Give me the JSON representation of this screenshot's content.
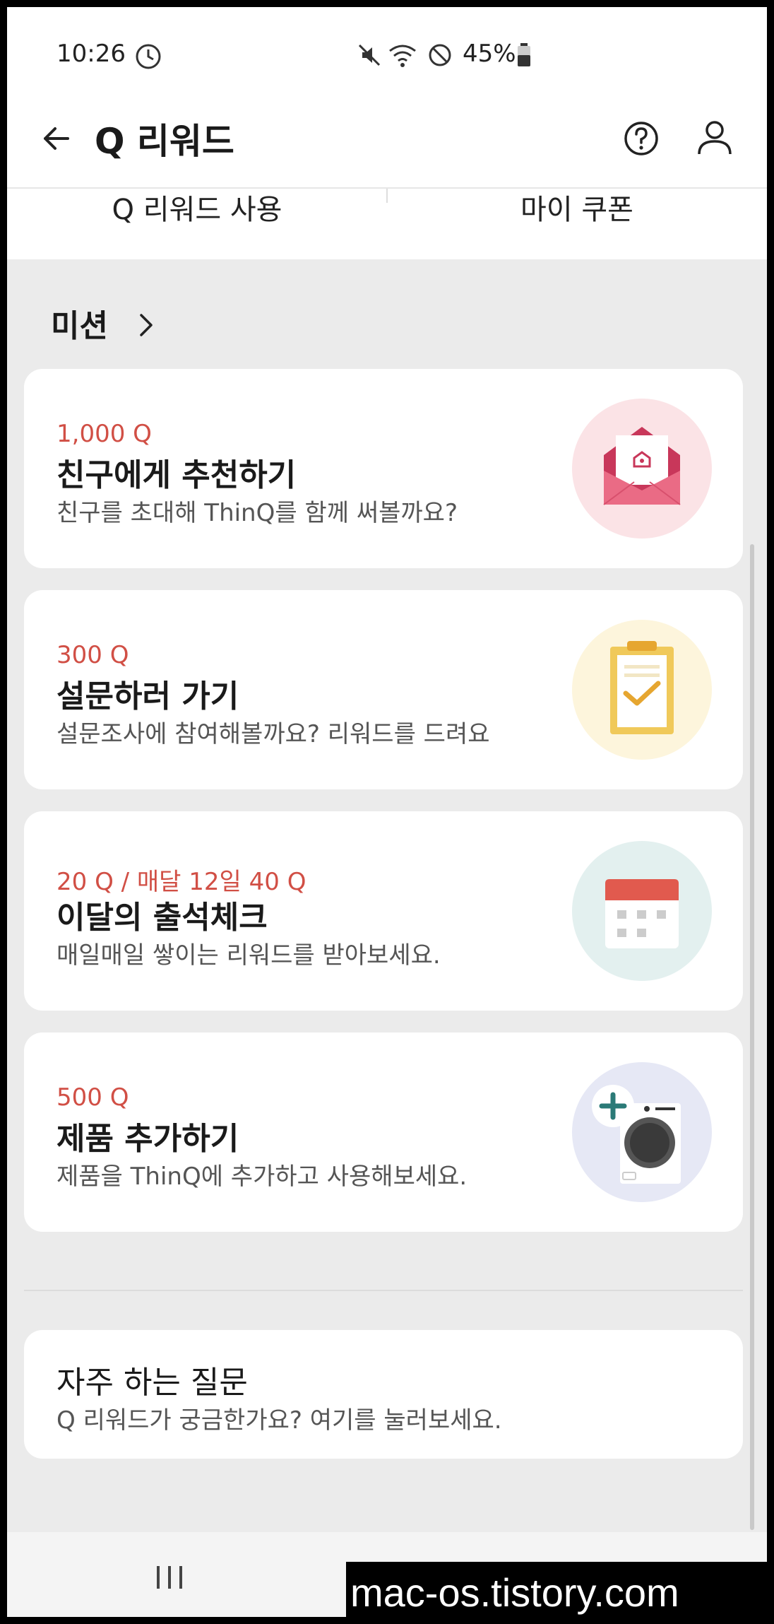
{
  "status_bar": {
    "time": "10:26",
    "battery": "45%"
  },
  "header": {
    "title": "Q 리워드"
  },
  "tabs": [
    {
      "label": "Q 리워드 사용"
    },
    {
      "label": "마이 쿠폰"
    }
  ],
  "mission": {
    "label": "미션"
  },
  "missions": [
    {
      "points": "1,000 Q",
      "title": "친구에게 추천하기",
      "desc": "친구를 초대해 ThinQ를 함께 써볼까요?",
      "icon": "envelope-icon",
      "bg": "#fbe3e6"
    },
    {
      "points": "300 Q",
      "title": "설문하러 가기",
      "desc": "설문조사에 참여해볼까요? 리워드를 드려요",
      "icon": "clipboard-check-icon",
      "bg": "#fdf5dc"
    },
    {
      "points": "20 Q / 매달 12일 40 Q",
      "title": "이달의 출석체크",
      "desc": "매일매일 쌓이는 리워드를 받아보세요.",
      "icon": "calendar-icon",
      "bg": "#e3f0ef"
    },
    {
      "points": "500 Q",
      "title": "제품 추가하기",
      "desc": "제품을 ThinQ에 추가하고 사용해보세요.",
      "icon": "washer-add-icon",
      "bg": "#e6e8f5"
    }
  ],
  "faq": {
    "title": "자주 하는 질문",
    "desc": "Q 리워드가 궁금한가요? 여기를 눌러보세요."
  },
  "watermark": "mac-os.tistory.com",
  "colors": {
    "accent": "#d14f45"
  }
}
